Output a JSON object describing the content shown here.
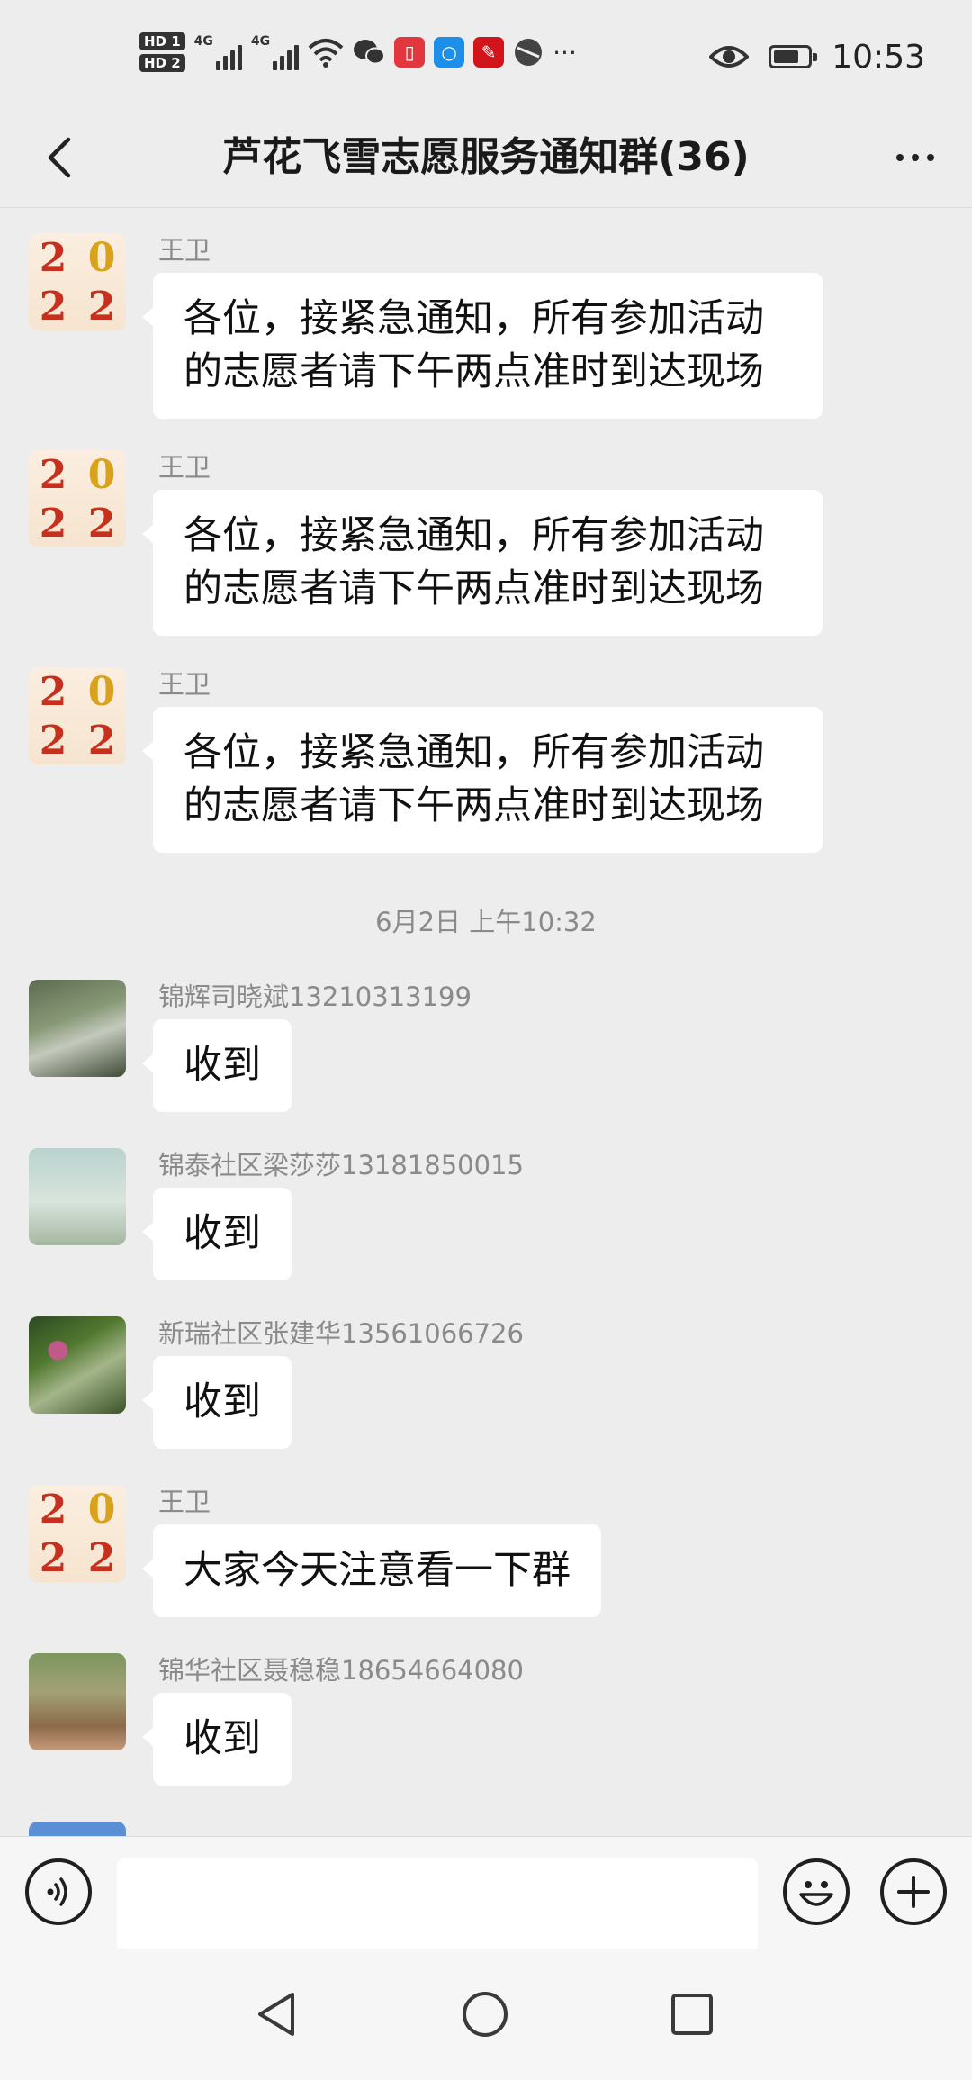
{
  "status_bar": {
    "hd1": "HD 1",
    "hd2": "HD 2",
    "net1": "4G",
    "net2": "4G",
    "time": "10:53",
    "battery_level": 0.75
  },
  "header": {
    "title": "芦花飞雪志愿服务通知群(36)"
  },
  "messages": [
    {
      "sender": "王卫",
      "text_line1": "各位，接紧急通知，所有参加活动",
      "text_line2": "的志愿者请下午两点准时到达现场"
    },
    {
      "sender": "王卫",
      "text_line1": "各位，接紧急通知，所有参加活动",
      "text_line2": "的志愿者请下午两点准时到达现场"
    },
    {
      "sender": "王卫",
      "text_line1": "各位，接紧急通知，所有参加活动",
      "text_line2": "的志愿者请下午两点准时到达现场"
    },
    {
      "sender": "锦辉司晓斌13210313199",
      "text": "收到"
    },
    {
      "sender": "锦泰社区梁莎莎13181850015",
      "text": "收到"
    },
    {
      "sender": "新瑞社区张建华13561066726",
      "text": "收到"
    },
    {
      "sender": "王卫",
      "text": "大家今天注意看一下群"
    },
    {
      "sender": "锦华社区聂稳稳18654664080",
      "text": "收到"
    }
  ],
  "time_separator": "6月2日 上午10:32",
  "tiger_avatar_glyphs": [
    "2",
    "0",
    "2",
    "2"
  ],
  "input": {
    "placeholder": ""
  },
  "colors": {
    "background": "#ededed",
    "bubble": "#ffffff",
    "sender_text": "#8a8a8a"
  }
}
